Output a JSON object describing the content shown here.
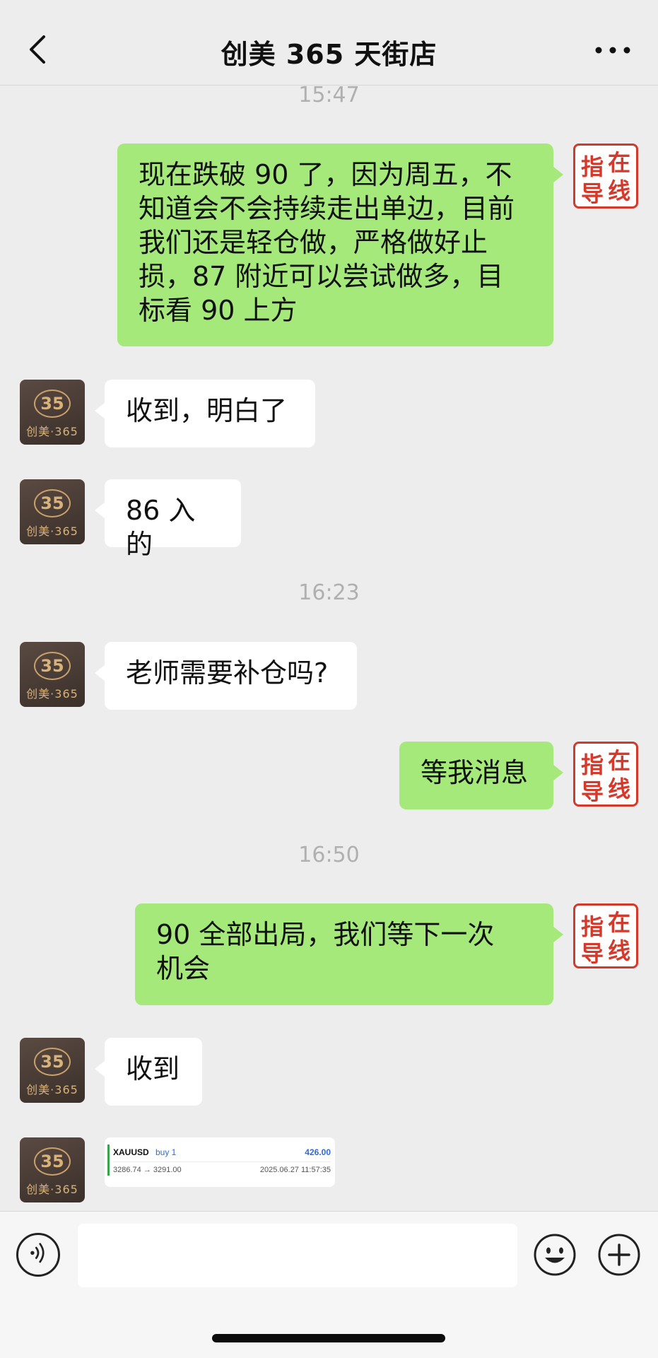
{
  "header": {
    "title": "创美 365 天街店"
  },
  "avatar": {
    "logo": "35",
    "brand": "创美·365"
  },
  "stamp": {
    "chars": [
      "在",
      "指",
      "线",
      "导"
    ]
  },
  "messages": [
    {
      "time": "15:47"
    },
    {
      "from": "me",
      "text": "现在跌破 90 了，因为周五，不\n知道会不会持续走出单边，目前\n我们还是轻仓做，严格做好止\n损，87 附近可以尝试做多，目\n标看 90 上方"
    },
    {
      "from": "them",
      "text": "收到，明白了"
    },
    {
      "from": "them",
      "text": "86 入的"
    },
    {
      "time": "16:23"
    },
    {
      "from": "them",
      "text": "老师需要补仓吗?"
    },
    {
      "from": "me",
      "text": "等我消息"
    },
    {
      "time": "16:50"
    },
    {
      "from": "me",
      "text": "90 全部出局，我们等下一次\n机会"
    },
    {
      "from": "them",
      "text": "收到"
    }
  ],
  "trade_card": {
    "symbol": "XAUUSD",
    "side": "buy 1",
    "amount": "426.00",
    "prices": "3286.74 → 3291.00",
    "timestamp": "2025.06.27 11:57:35"
  },
  "colors": {
    "outgoing": "#a5e97a",
    "incoming": "#ffffff",
    "stamp": "#d33a2c",
    "background": "#ededed"
  }
}
